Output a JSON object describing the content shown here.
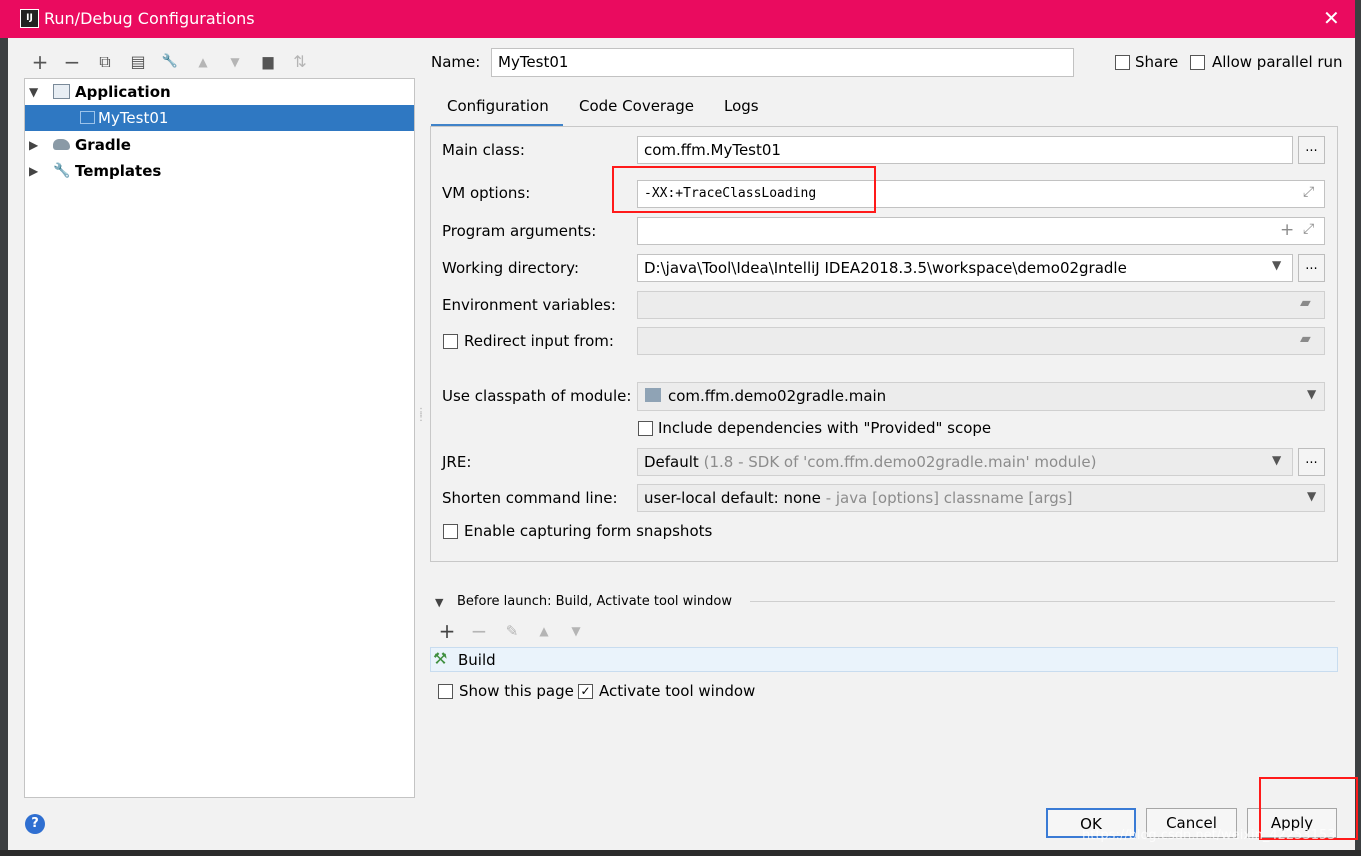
{
  "window": {
    "title": "Run/Debug Configurations",
    "app_icon_text": "IJ"
  },
  "toolbar": {
    "add": "+",
    "remove": "−",
    "copy": "⧉",
    "save": "▤",
    "edit": "🔧",
    "up": "▲",
    "down": "▼",
    "folder": "▆",
    "sort": "⇅"
  },
  "tree": {
    "application": "Application",
    "mytest": "MyTest01",
    "gradle": "Gradle",
    "templates": "Templates"
  },
  "header": {
    "name_label": "Name:",
    "name_value": "MyTest01",
    "share_label": "Share",
    "allow_parallel_label": "Allow parallel run"
  },
  "tabs": [
    "Configuration",
    "Code Coverage",
    "Logs"
  ],
  "form": {
    "main_class_label": "Main class:",
    "main_class_value": "com.ffm.MyTest01",
    "vm_options_label": "VM options:",
    "vm_options_value": "-XX:+TraceClassLoading",
    "program_args_label": "Program arguments:",
    "working_dir_label": "Working directory:",
    "working_dir_value": "D:\\java\\Tool\\Idea\\IntelliJ IDEA2018.3.5\\workspace\\demo02gradle",
    "env_vars_label": "Environment variables:",
    "redirect_label": "Redirect input from:",
    "classpath_label": "Use classpath of module:",
    "classpath_value": "com.ffm.demo02gradle.main",
    "include_deps_label": "Include dependencies with \"Provided\" scope",
    "jre_label": "JRE:",
    "jre_value": "Default",
    "jre_hint": "(1.8 - SDK of 'com.ffm.demo02gradle.main' module)",
    "shorten_label": "Shorten command line:",
    "shorten_value": "user-local default: none",
    "shorten_hint": "- java [options] classname [args]",
    "snapshots_label": "Enable capturing form snapshots",
    "dots": "..."
  },
  "before_launch": {
    "title": "Before launch: Build, Activate tool window",
    "build_item": "Build",
    "show_page_label": "Show this page",
    "activate_label": "Activate tool window"
  },
  "buttons": {
    "ok": "OK",
    "cancel": "Cancel",
    "apply": "Apply",
    "help": "?"
  },
  "watermark": "https://blog.csdn.net/weixin_42253153"
}
